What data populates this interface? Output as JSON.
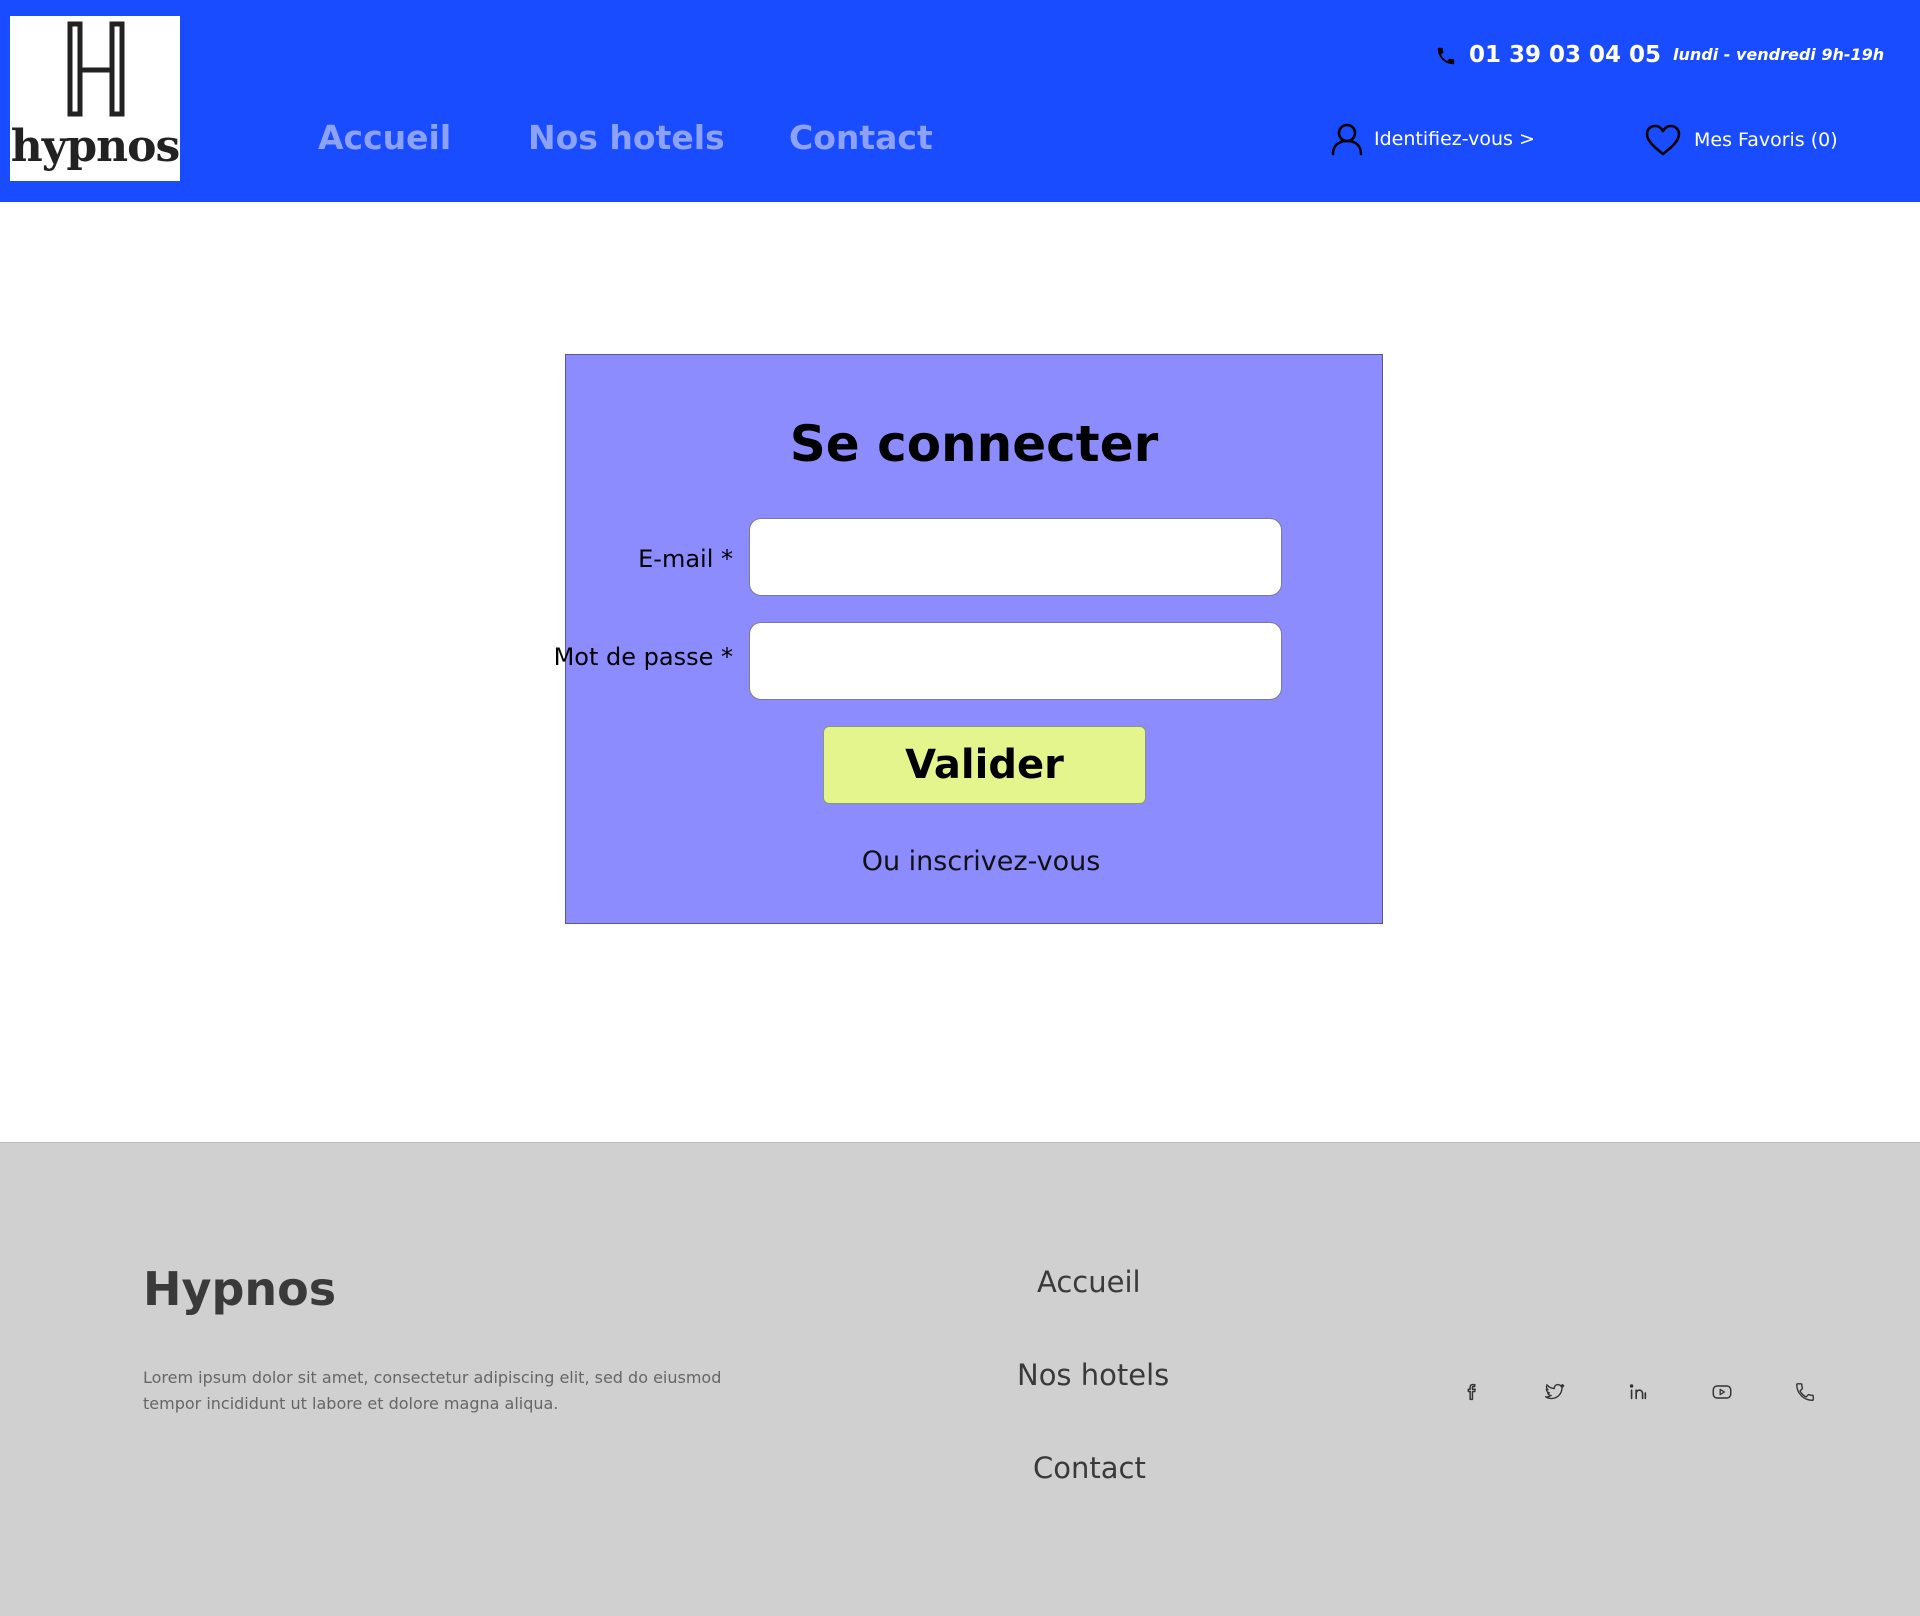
{
  "header": {
    "logo_text": "hypnos",
    "nav": {
      "accueil": "Accueil",
      "hotels": "Nos hotels",
      "contact": "Contact"
    },
    "phone": "01 39 03 04 05",
    "hours": "lundi - vendredi 9h-19h",
    "login_label": "Identifiez-vous >",
    "favorites_label": "Mes Favoris (0)"
  },
  "login": {
    "title": "Se connecter",
    "email_label": "E-mail *",
    "email_value": "",
    "password_label": "Mot de passe *",
    "password_value": "",
    "submit_label": "Valider",
    "register_label": "Ou inscrivez-vous"
  },
  "footer": {
    "brand": "Hypnos",
    "description": "Lorem ipsum dolor sit amet, consectetur adipiscing elit, sed do eiusmod tempor incididunt ut labore et dolore magna aliqua.",
    "links": {
      "accueil": "Accueil",
      "hotels": "Nos hotels",
      "contact": "Contact"
    },
    "social_icons": [
      "facebook-icon",
      "twitter-icon",
      "linkedin-icon",
      "youtube-icon",
      "phone-icon"
    ]
  },
  "colors": {
    "header_bg": "#1a4cff",
    "nav_text": "#8da2ff",
    "card_bg": "#8c8cff",
    "button_bg": "#e5f58e",
    "footer_bg": "#d0d0d0"
  }
}
